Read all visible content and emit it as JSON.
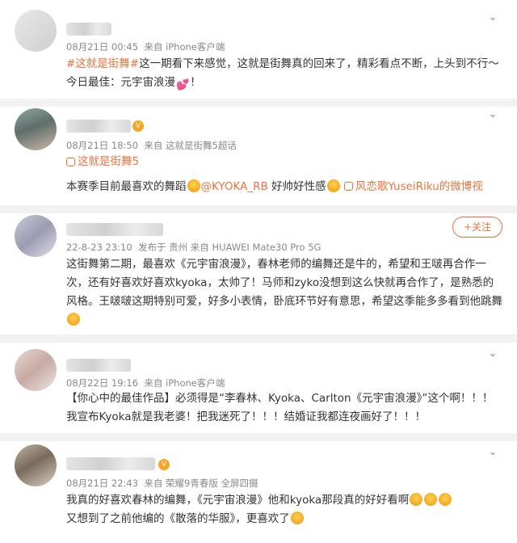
{
  "posts": [
    {
      "time": "08月21日 00:45",
      "source": "来自 iPhone客户端",
      "text_tag": "#这就是街舞#",
      "text_main": "这一期看下来感觉，这就是街舞真的回来了，精彩看点不断，上头到不行～今日最佳：元宇宙浪漫",
      "text_end": "！"
    },
    {
      "time": "08月21日 18:50",
      "source": "来自 这就是街舞5超话",
      "topic": "这就是街舞5",
      "text_a": "本赛季目前最喜欢的舞蹈",
      "mention": "@KYOKA_RB",
      "text_b": " 好帅好性感",
      "video_link": "风恋歌YuseiRiku的微博视"
    },
    {
      "time": "22-8-23 23:10",
      "source": "发布于 贵州  来自 HUAWEI Mate30 Pro 5G",
      "follow_label": "+关注",
      "text": "这街舞第二期，最喜欢《元宇宙浪漫》，春林老师的编舞还是牛的，希望和王啵再合作一次，还有好喜欢好喜欢kyoka，太帅了！马师和zyko没想到这么快就再合作了，是熟悉的风格。王啵啵这期特别可爱，好多小表情，卧底环节好有意思，希望这季能多多看到他跳舞"
    },
    {
      "time": "08月22日 19:16",
      "source": "来自 iPhone客户端",
      "text": "【你心中的最佳作品】必须得是“李春林、Kyoka、Carlton《元宇宙浪漫》”这个啊！！！我宣布Kyoka就是我老婆！把我迷死了！！！结婚证我都连夜画好了！！！"
    },
    {
      "time": "08月21日 22:43",
      "source": "来自 荣耀9青春版 全屏四摄",
      "text_line1": "我真的好喜欢春林的编舞，《元宇宙浪漫》他和kyoka那段真的好好看啊",
      "text_line2": "又想到了之前他编的《散落的华服》，更喜欢了"
    }
  ],
  "icons": {
    "chevron": "⌄"
  }
}
